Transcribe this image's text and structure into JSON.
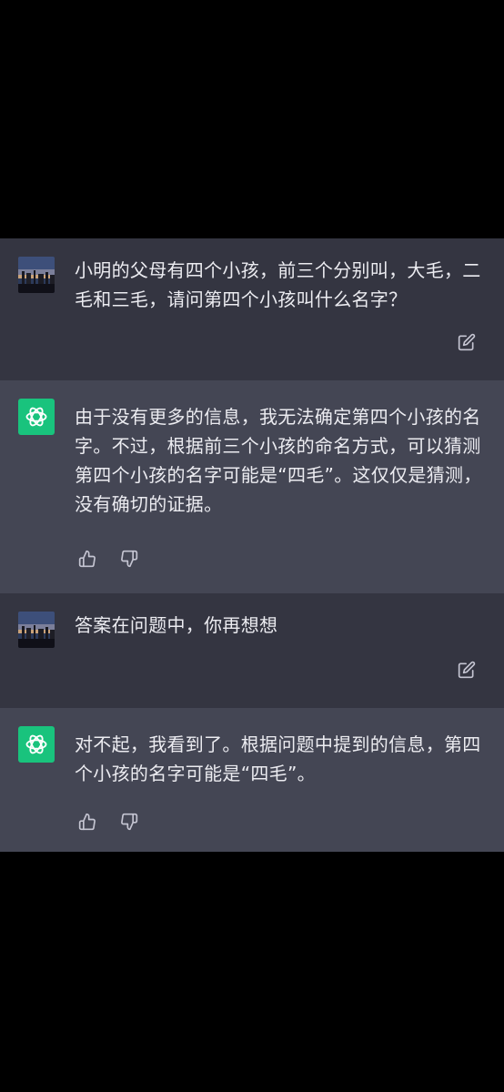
{
  "conversation": {
    "messages": [
      {
        "role": "user",
        "avatar": "user-avatar-photo",
        "text": "小明的父母有四个小孩，前三个分别叫，大毛，二毛和三毛，请问第四个小孩叫什么名字？",
        "edit_icon": "edit-icon"
      },
      {
        "role": "assistant",
        "avatar": "chatgpt-logo-icon",
        "text": "由于没有更多的信息，我无法确定第四个小孩的名字。不过，根据前三个小孩的命名方式，可以猜测第四个小孩的名字可能是“四毛”。这仅仅是猜测，没有确切的证据。",
        "actions": [
          "thumbs-up-icon",
          "thumbs-down-icon"
        ]
      },
      {
        "role": "user",
        "avatar": "user-avatar-photo",
        "text": "答案在问题中，你再想想",
        "edit_icon": "edit-icon"
      },
      {
        "role": "assistant",
        "avatar": "chatgpt-logo-icon",
        "text": "对不起，我看到了。根据问题中提到的信息，第四个小孩的名字可能是“四毛”。",
        "actions": [
          "thumbs-up-icon",
          "thumbs-down-icon"
        ]
      }
    ]
  },
  "colors": {
    "background": "#000000",
    "user_bubble": "#343541",
    "assistant_bubble": "#444654",
    "text": "#ececf1",
    "icon": "#c5c5d2",
    "logo_bg": "#19c37d"
  }
}
